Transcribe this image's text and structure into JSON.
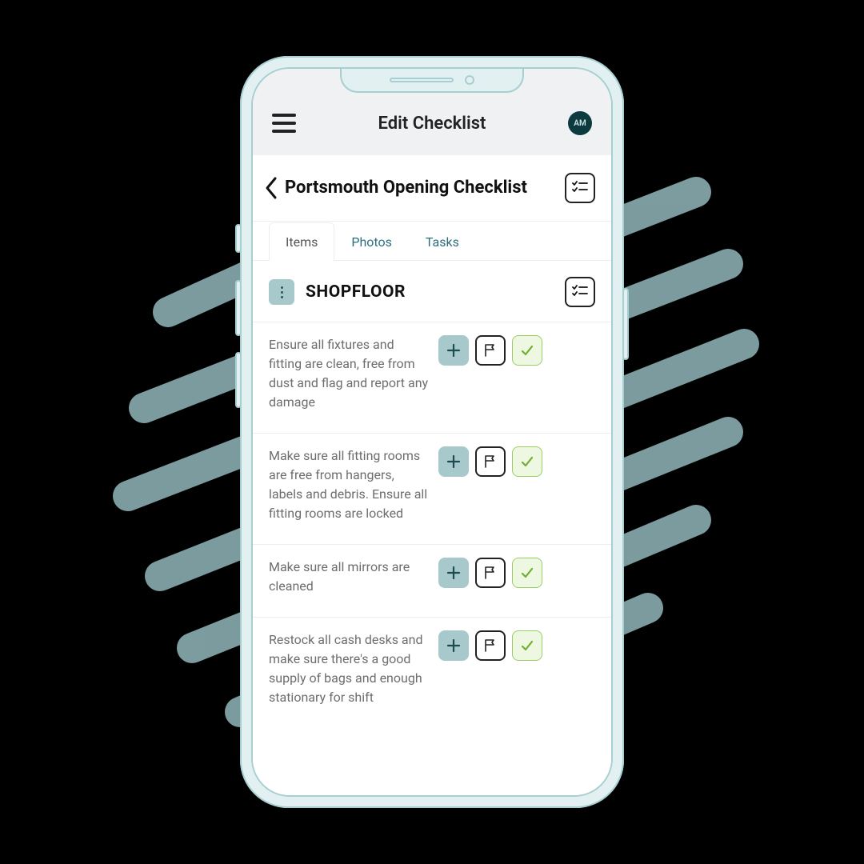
{
  "header": {
    "title": "Edit Checklist",
    "avatar_initials": "AM"
  },
  "checklist": {
    "title": "Portsmouth Opening Checklist"
  },
  "tabs": [
    {
      "label": "Items",
      "active": true
    },
    {
      "label": "Photos",
      "active": false
    },
    {
      "label": "Tasks",
      "active": false
    }
  ],
  "section": {
    "title": "SHOPFLOOR"
  },
  "items": [
    {
      "text": "Ensure all fixtures and fitting are clean, free from dust and flag and report any damage"
    },
    {
      "text": "Make sure all fitting rooms are free from hangers, labels and debris. Ensure all fitting rooms are locked"
    },
    {
      "text": "Make sure all mirrors are cleaned"
    },
    {
      "text": "Restock all cash desks and make sure there's a good supply of bags and enough stationary for shift"
    }
  ],
  "colors": {
    "accent_teal": "#a8c9cc",
    "check_green": "#8bc34a",
    "dark_teal": "#0d3a3e"
  }
}
